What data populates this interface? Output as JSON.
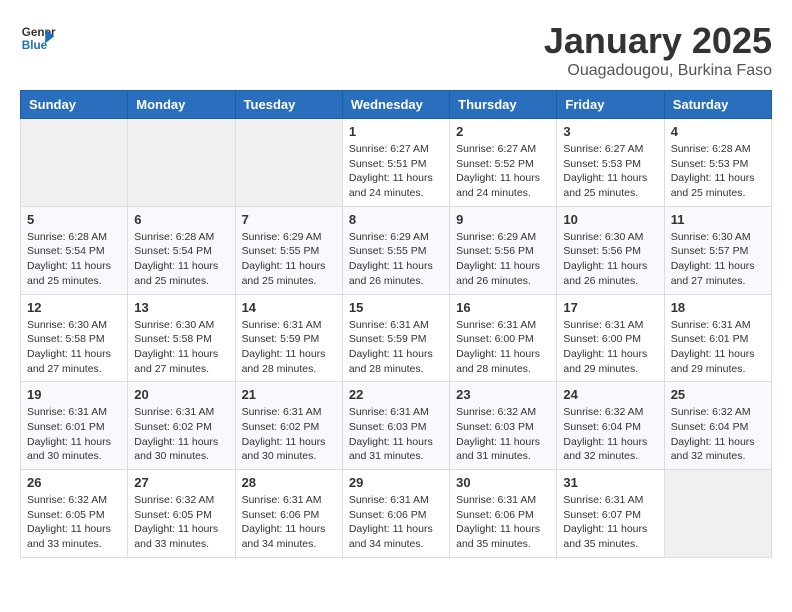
{
  "header": {
    "logo_line1": "General",
    "logo_line2": "Blue",
    "month_title": "January 2025",
    "location": "Ouagadougou, Burkina Faso"
  },
  "weekdays": [
    "Sunday",
    "Monday",
    "Tuesday",
    "Wednesday",
    "Thursday",
    "Friday",
    "Saturday"
  ],
  "weeks": [
    [
      {
        "day": "",
        "sunrise": "",
        "sunset": "",
        "daylight": ""
      },
      {
        "day": "",
        "sunrise": "",
        "sunset": "",
        "daylight": ""
      },
      {
        "day": "",
        "sunrise": "",
        "sunset": "",
        "daylight": ""
      },
      {
        "day": "1",
        "sunrise": "Sunrise: 6:27 AM",
        "sunset": "Sunset: 5:51 PM",
        "daylight": "Daylight: 11 hours and 24 minutes."
      },
      {
        "day": "2",
        "sunrise": "Sunrise: 6:27 AM",
        "sunset": "Sunset: 5:52 PM",
        "daylight": "Daylight: 11 hours and 24 minutes."
      },
      {
        "day": "3",
        "sunrise": "Sunrise: 6:27 AM",
        "sunset": "Sunset: 5:53 PM",
        "daylight": "Daylight: 11 hours and 25 minutes."
      },
      {
        "day": "4",
        "sunrise": "Sunrise: 6:28 AM",
        "sunset": "Sunset: 5:53 PM",
        "daylight": "Daylight: 11 hours and 25 minutes."
      }
    ],
    [
      {
        "day": "5",
        "sunrise": "Sunrise: 6:28 AM",
        "sunset": "Sunset: 5:54 PM",
        "daylight": "Daylight: 11 hours and 25 minutes."
      },
      {
        "day": "6",
        "sunrise": "Sunrise: 6:28 AM",
        "sunset": "Sunset: 5:54 PM",
        "daylight": "Daylight: 11 hours and 25 minutes."
      },
      {
        "day": "7",
        "sunrise": "Sunrise: 6:29 AM",
        "sunset": "Sunset: 5:55 PM",
        "daylight": "Daylight: 11 hours and 25 minutes."
      },
      {
        "day": "8",
        "sunrise": "Sunrise: 6:29 AM",
        "sunset": "Sunset: 5:55 PM",
        "daylight": "Daylight: 11 hours and 26 minutes."
      },
      {
        "day": "9",
        "sunrise": "Sunrise: 6:29 AM",
        "sunset": "Sunset: 5:56 PM",
        "daylight": "Daylight: 11 hours and 26 minutes."
      },
      {
        "day": "10",
        "sunrise": "Sunrise: 6:30 AM",
        "sunset": "Sunset: 5:56 PM",
        "daylight": "Daylight: 11 hours and 26 minutes."
      },
      {
        "day": "11",
        "sunrise": "Sunrise: 6:30 AM",
        "sunset": "Sunset: 5:57 PM",
        "daylight": "Daylight: 11 hours and 27 minutes."
      }
    ],
    [
      {
        "day": "12",
        "sunrise": "Sunrise: 6:30 AM",
        "sunset": "Sunset: 5:58 PM",
        "daylight": "Daylight: 11 hours and 27 minutes."
      },
      {
        "day": "13",
        "sunrise": "Sunrise: 6:30 AM",
        "sunset": "Sunset: 5:58 PM",
        "daylight": "Daylight: 11 hours and 27 minutes."
      },
      {
        "day": "14",
        "sunrise": "Sunrise: 6:31 AM",
        "sunset": "Sunset: 5:59 PM",
        "daylight": "Daylight: 11 hours and 28 minutes."
      },
      {
        "day": "15",
        "sunrise": "Sunrise: 6:31 AM",
        "sunset": "Sunset: 5:59 PM",
        "daylight": "Daylight: 11 hours and 28 minutes."
      },
      {
        "day": "16",
        "sunrise": "Sunrise: 6:31 AM",
        "sunset": "Sunset: 6:00 PM",
        "daylight": "Daylight: 11 hours and 28 minutes."
      },
      {
        "day": "17",
        "sunrise": "Sunrise: 6:31 AM",
        "sunset": "Sunset: 6:00 PM",
        "daylight": "Daylight: 11 hours and 29 minutes."
      },
      {
        "day": "18",
        "sunrise": "Sunrise: 6:31 AM",
        "sunset": "Sunset: 6:01 PM",
        "daylight": "Daylight: 11 hours and 29 minutes."
      }
    ],
    [
      {
        "day": "19",
        "sunrise": "Sunrise: 6:31 AM",
        "sunset": "Sunset: 6:01 PM",
        "daylight": "Daylight: 11 hours and 30 minutes."
      },
      {
        "day": "20",
        "sunrise": "Sunrise: 6:31 AM",
        "sunset": "Sunset: 6:02 PM",
        "daylight": "Daylight: 11 hours and 30 minutes."
      },
      {
        "day": "21",
        "sunrise": "Sunrise: 6:31 AM",
        "sunset": "Sunset: 6:02 PM",
        "daylight": "Daylight: 11 hours and 30 minutes."
      },
      {
        "day": "22",
        "sunrise": "Sunrise: 6:31 AM",
        "sunset": "Sunset: 6:03 PM",
        "daylight": "Daylight: 11 hours and 31 minutes."
      },
      {
        "day": "23",
        "sunrise": "Sunrise: 6:32 AM",
        "sunset": "Sunset: 6:03 PM",
        "daylight": "Daylight: 11 hours and 31 minutes."
      },
      {
        "day": "24",
        "sunrise": "Sunrise: 6:32 AM",
        "sunset": "Sunset: 6:04 PM",
        "daylight": "Daylight: 11 hours and 32 minutes."
      },
      {
        "day": "25",
        "sunrise": "Sunrise: 6:32 AM",
        "sunset": "Sunset: 6:04 PM",
        "daylight": "Daylight: 11 hours and 32 minutes."
      }
    ],
    [
      {
        "day": "26",
        "sunrise": "Sunrise: 6:32 AM",
        "sunset": "Sunset: 6:05 PM",
        "daylight": "Daylight: 11 hours and 33 minutes."
      },
      {
        "day": "27",
        "sunrise": "Sunrise: 6:32 AM",
        "sunset": "Sunset: 6:05 PM",
        "daylight": "Daylight: 11 hours and 33 minutes."
      },
      {
        "day": "28",
        "sunrise": "Sunrise: 6:31 AM",
        "sunset": "Sunset: 6:06 PM",
        "daylight": "Daylight: 11 hours and 34 minutes."
      },
      {
        "day": "29",
        "sunrise": "Sunrise: 6:31 AM",
        "sunset": "Sunset: 6:06 PM",
        "daylight": "Daylight: 11 hours and 34 minutes."
      },
      {
        "day": "30",
        "sunrise": "Sunrise: 6:31 AM",
        "sunset": "Sunset: 6:06 PM",
        "daylight": "Daylight: 11 hours and 35 minutes."
      },
      {
        "day": "31",
        "sunrise": "Sunrise: 6:31 AM",
        "sunset": "Sunset: 6:07 PM",
        "daylight": "Daylight: 11 hours and 35 minutes."
      },
      {
        "day": "",
        "sunrise": "",
        "sunset": "",
        "daylight": ""
      }
    ]
  ]
}
